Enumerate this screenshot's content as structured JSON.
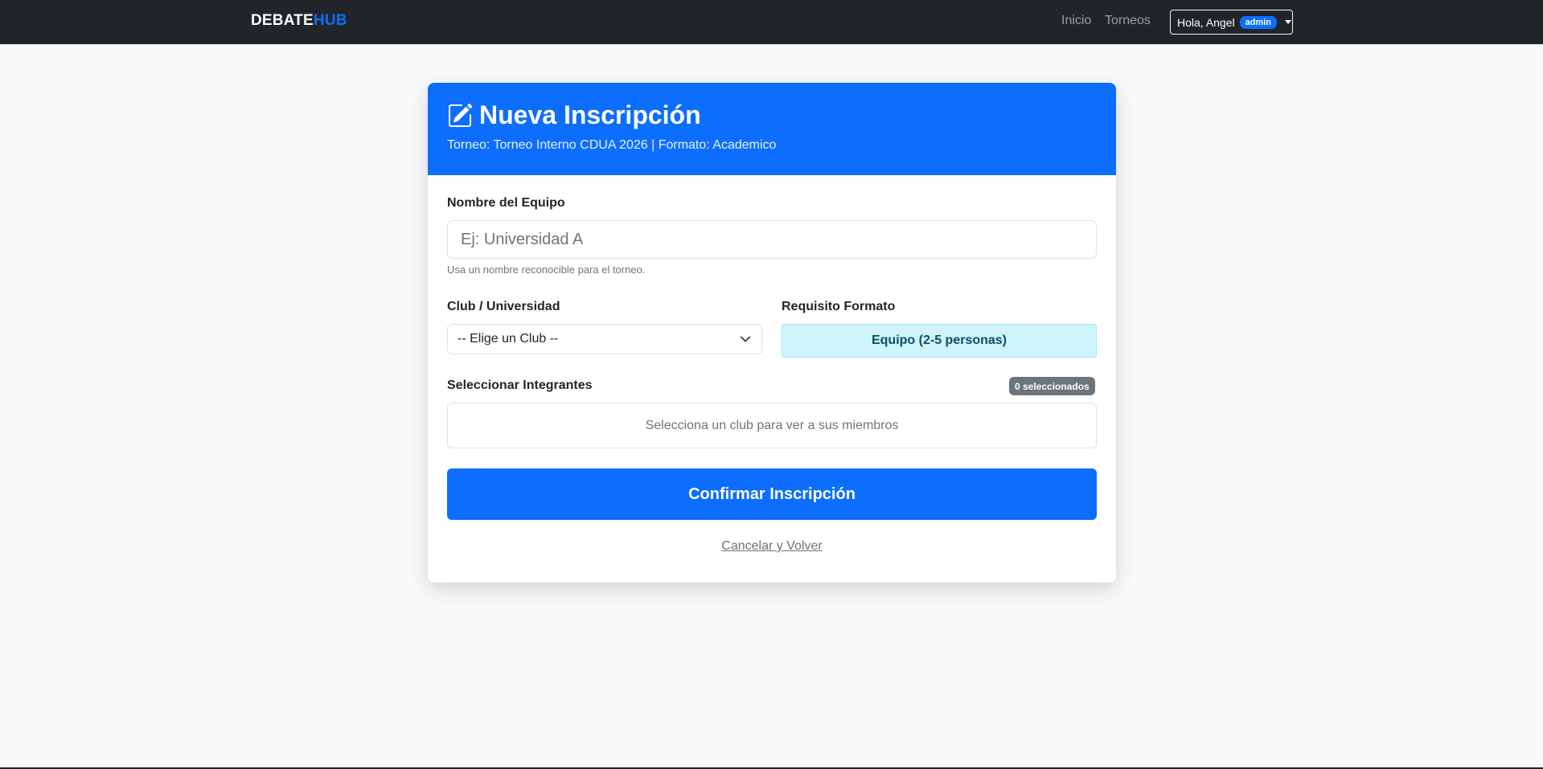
{
  "navbar": {
    "brand_part1": "DEBATE",
    "brand_part2": "HUB",
    "links": [
      "Inicio",
      "Torneos"
    ],
    "user_greeting": "Hola, Angel",
    "user_role": "admin"
  },
  "card": {
    "title": "Nueva Inscripción",
    "subtitle": "Torneo: Torneo Interno CDUA 2026 | Formato: Academico",
    "team_label": "Nombre del Equipo",
    "team_placeholder": "Ej: Universidad A",
    "team_help": "Usa un nombre reconocible para el torneo.",
    "club_label": "Club / Universidad",
    "club_selected": "-- Elige un Club --",
    "format_label": "Requisito Formato",
    "format_value": "Equipo (2-5 personas)",
    "members_label": "Seleccionar Integrantes",
    "members_count": "0 seleccionados",
    "members_empty": "Selecciona un club para ver a sus miembros",
    "confirm_label": "Confirmar Inscripción",
    "cancel_label": "Cancelar y Volver"
  },
  "icons": {
    "title_icon": "pencil-square-icon",
    "select_icon": "chevron-down-icon",
    "dropdown_icon": "caret-down-icon"
  },
  "colors": {
    "navbar_bg": "#212529",
    "primary": "#0d6efd",
    "info_bg": "#cff4fc",
    "info_text": "#055160",
    "secondary": "#6c757d"
  }
}
